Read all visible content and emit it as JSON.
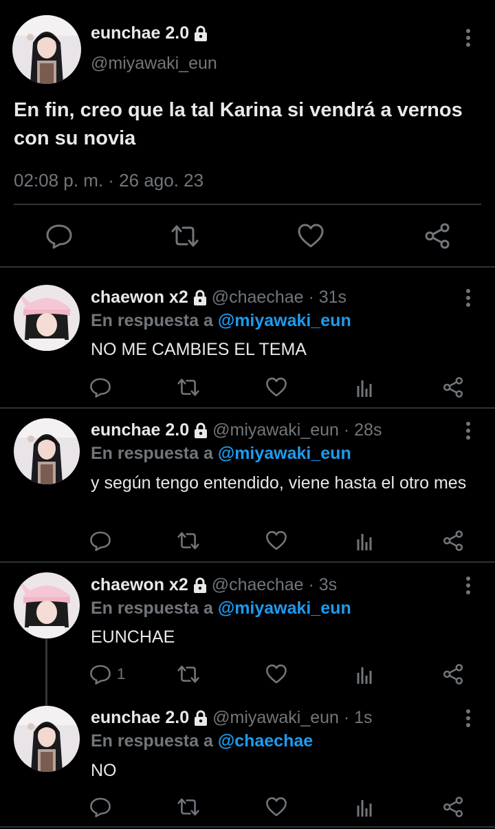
{
  "main_tweet": {
    "name": "eunchae 2.0",
    "handle": "@miyawaki_eun",
    "text": "En fin, creo que la tal Karina si vendrá a vernos con su novia",
    "time": "02:08 p. m. · 26 ago. 23",
    "actions": [
      "reply-icon",
      "retweet-icon",
      "like-icon",
      "share-icon"
    ]
  },
  "replies": [
    {
      "name": "chaewon x2",
      "meta": "@chaechae · 31s",
      "reply_prefix": "En respuesta a",
      "reply_to": "@miyawaki_eun",
      "text": "NO ME CAMBIES EL TEMA",
      "reply_count": ""
    },
    {
      "name": "eunchae 2.0",
      "meta": "@miyawaki_eun · 28s",
      "reply_prefix": "En respuesta a",
      "reply_to": "@miyawaki_eun",
      "text": "y según tengo entendido, viene hasta el otro mes",
      "reply_count": ""
    },
    {
      "name": "chaewon x2",
      "meta": "@chaechae · 3s",
      "reply_prefix": "En respuesta a",
      "reply_to": "@miyawaki_eun",
      "text": "EUNCHAE",
      "reply_count": "1"
    },
    {
      "name": "eunchae 2.0",
      "meta": "@miyawaki_eun · 1s",
      "reply_prefix": "En respuesta a",
      "reply_to": "@chaechae",
      "text": "NO",
      "reply_count": ""
    }
  ],
  "colors": {
    "background": "#000000",
    "text": "#e7e9ea",
    "muted": "#71767b",
    "link": "#1d9bf0",
    "divider": "#2f3336"
  }
}
